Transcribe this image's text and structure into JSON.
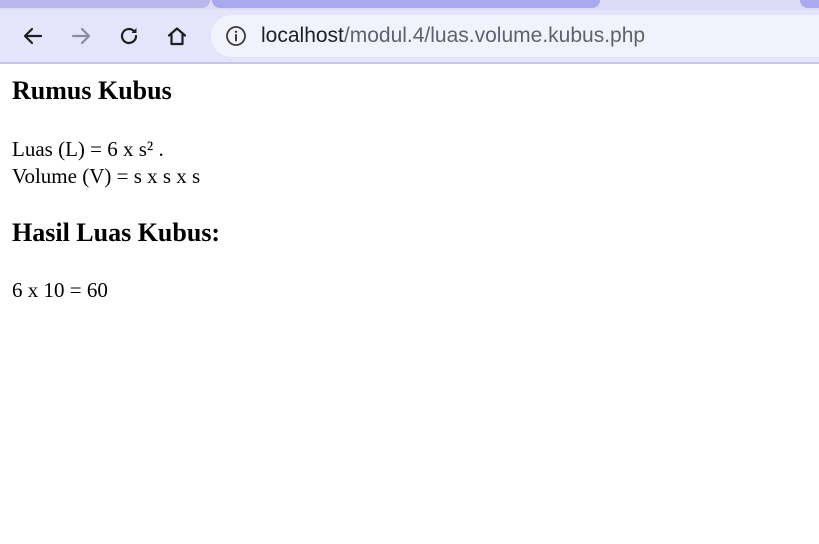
{
  "browser": {
    "url_host": "localhost",
    "url_path": "/modul.4/luas.volume.kubus.php",
    "icons": [
      "back-arrow-icon",
      "forward-arrow-icon",
      "reload-icon",
      "home-icon",
      "info-icon"
    ]
  },
  "page": {
    "heading_formula": "Rumus Kubus",
    "luas_formula": "Luas (L) = 6 x s² .",
    "volume_formula": "Volume (V) = s x s x s",
    "heading_result": "Hasil Luas Kubus:",
    "result": "6 x 10 = 60"
  },
  "colors": {
    "toolbar": "#e4e4fb",
    "omnibox": "#f2f2fc",
    "tab_active": "#a9a9ef"
  }
}
